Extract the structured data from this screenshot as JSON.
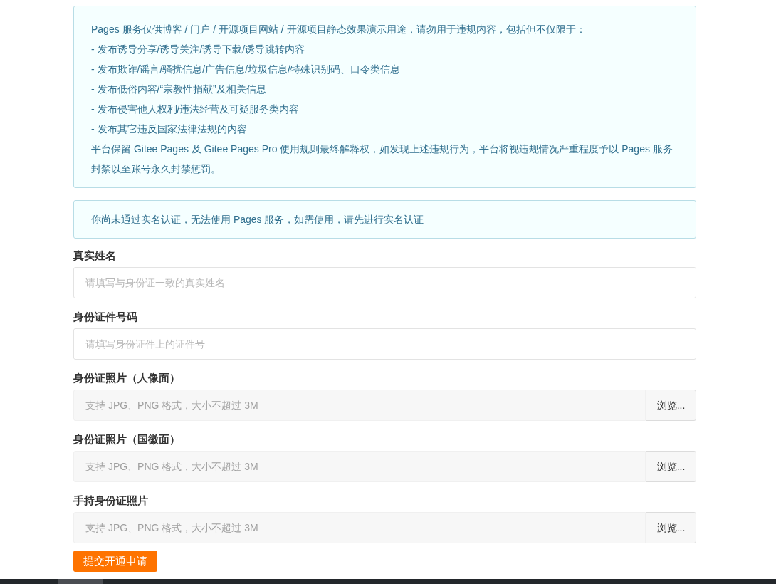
{
  "notice": {
    "lines": [
      "Pages 服务仅供博客 / 门户 / 开源项目网站 / 开源项目静态效果演示用途，请勿用于违规内容，包括但不仅限于：",
      "- 发布诱导分享/诱导关注/诱导下载/诱导跳转内容",
      "- 发布欺诈/谣言/骚扰信息/广告信息/垃圾信息/特殊识别码、口令类信息",
      "- 发布低俗内容/“宗教性捐献”及相关信息",
      "- 发布侵害他人权利/违法经营及可疑服务类内容",
      "- 发布其它违反国家法律法规的内容",
      "平台保留 Gitee Pages 及 Gitee Pages Pro 使用规则最终解释权，如发现上述违规行为，平台将视违规情况严重程度予以 Pages 服务封禁以至账号永久封禁惩罚。"
    ]
  },
  "alert": "你尚未通过实名认证，无法使用 Pages 服务，如需使用，请先进行实名认证",
  "fields": [
    {
      "kind": "text",
      "label": "真实姓名",
      "placeholder": "请填写与身份证一致的真实姓名"
    },
    {
      "kind": "text",
      "label": "身份证件号码",
      "placeholder": "请填写身份证件上的证件号"
    },
    {
      "kind": "file",
      "label": "身份证照片（人像面）",
      "placeholder": "支持 JPG、PNG 格式，大小不超过 3M",
      "button": "浏览..."
    },
    {
      "kind": "file",
      "label": "身份证照片（国徽面）",
      "placeholder": "支持 JPG、PNG 格式，大小不超过 3M",
      "button": "浏览..."
    },
    {
      "kind": "file",
      "label": "手持身份证照片",
      "placeholder": "支持 JPG、PNG 格式，大小不超过 3M",
      "button": "浏览..."
    }
  ],
  "submit": "提交开通申请"
}
